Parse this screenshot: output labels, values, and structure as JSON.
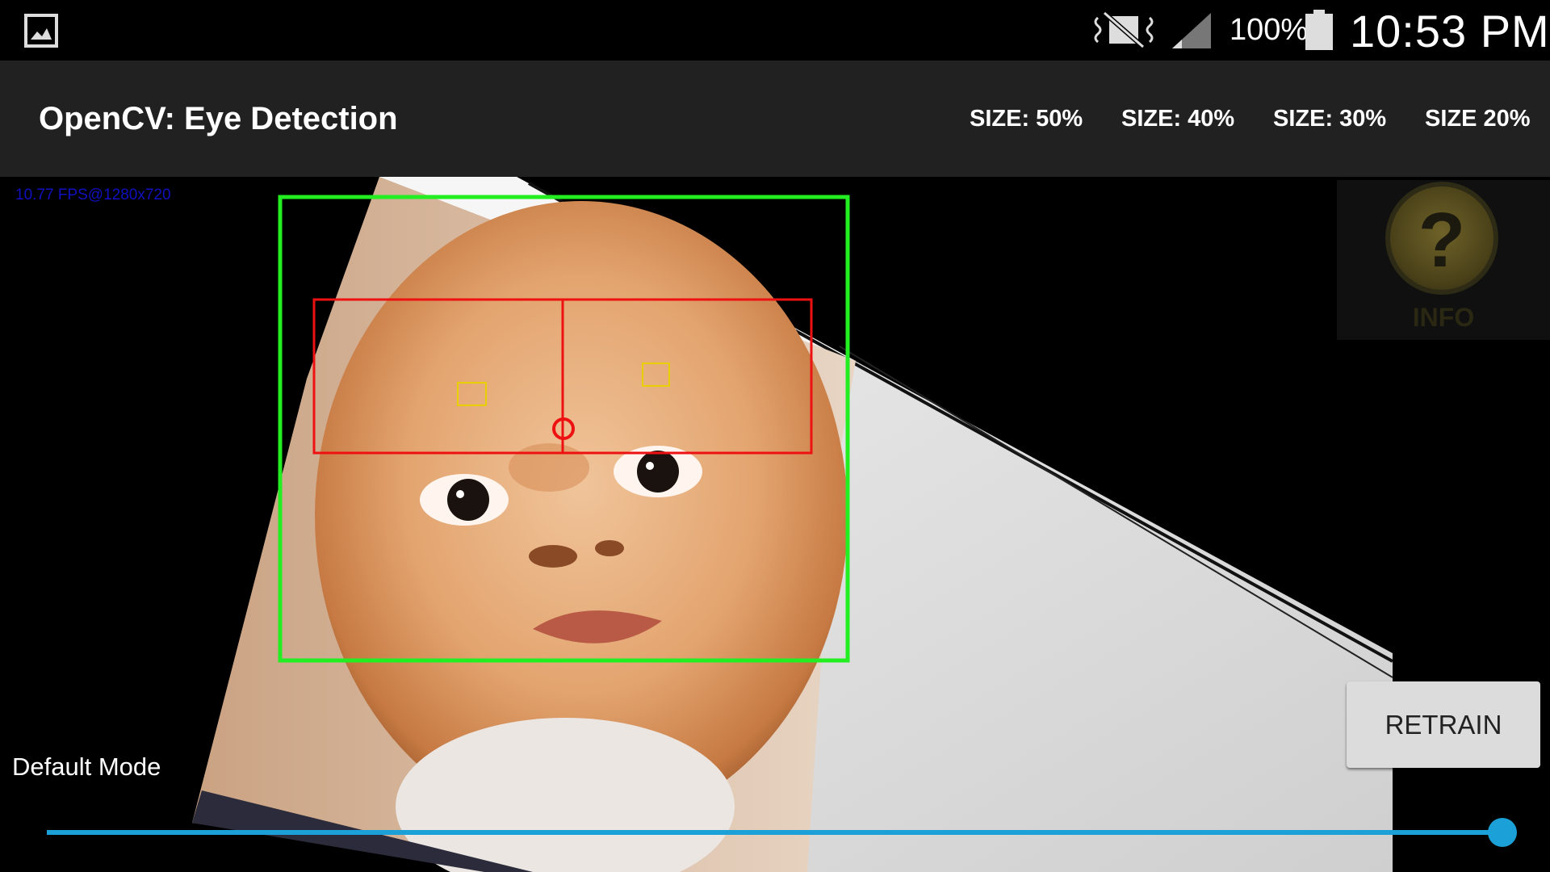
{
  "status_bar": {
    "icons": [
      "gallery-icon",
      "mute-vibrate-icon",
      "signal-icon",
      "battery-icon"
    ],
    "battery_percent": "100%",
    "time": "10:53 PM"
  },
  "action_bar": {
    "title": "OpenCV: Eye Detection",
    "size_options": [
      "SIZE: 50%",
      "SIZE: 40%",
      "SIZE: 30%",
      "SIZE 20%"
    ]
  },
  "camera": {
    "fps_label": "10.77 FPS@1280x720"
  },
  "info_button": {
    "icon": "question-mark-icon",
    "label": "INFO"
  },
  "retrain_button": {
    "label": "RETRAIN"
  },
  "mode": {
    "label": "Default Mode"
  },
  "slider": {
    "value_fraction": 1.0,
    "color": "#1ba1d8"
  },
  "detection_colors": {
    "face_box": "#22ee22",
    "eye_region": "#ee1111",
    "pupil_box": "#e8d000"
  }
}
